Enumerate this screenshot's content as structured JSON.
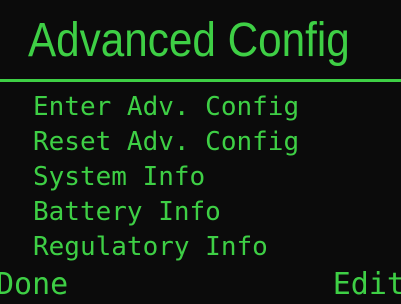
{
  "screen": {
    "title": "Advanced Config",
    "menu": [
      {
        "label": "Enter Adv. Config"
      },
      {
        "label": "Reset Adv. Config"
      },
      {
        "label": "System Info"
      },
      {
        "label": "Battery Info"
      },
      {
        "label": "Regulatory Info"
      }
    ],
    "softkeys": {
      "left": "Done",
      "right": "Edit"
    }
  },
  "colors": {
    "background": "#0b0b0b",
    "foreground": "#3ecf45"
  }
}
